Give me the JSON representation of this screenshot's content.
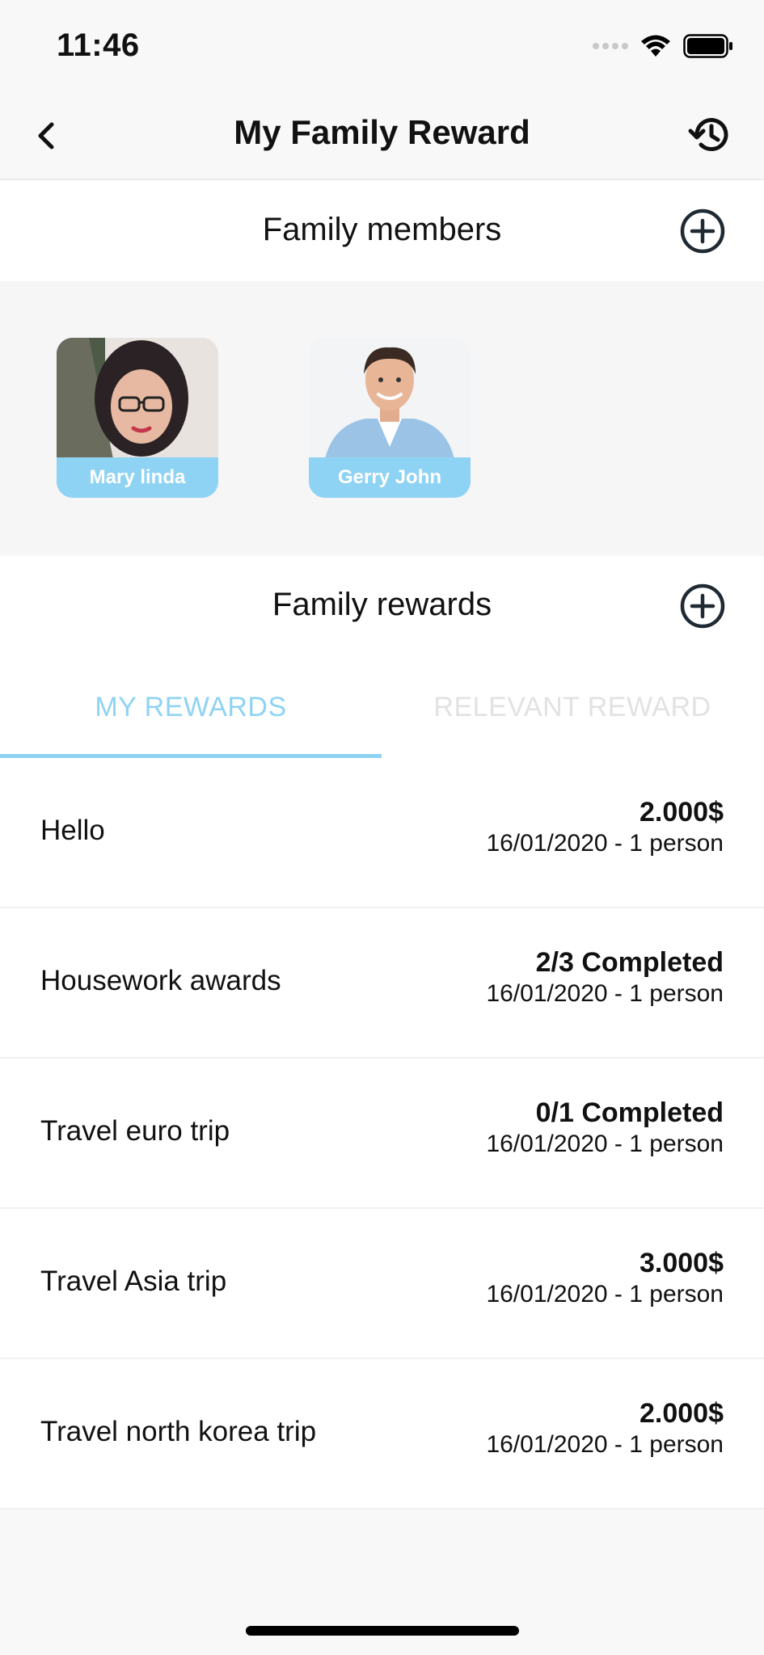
{
  "status_bar": {
    "time": "11:46"
  },
  "nav": {
    "title": "My Family Reward"
  },
  "members_section": {
    "title": "Family members"
  },
  "members": [
    {
      "name": "Mary linda"
    },
    {
      "name": "Gerry John"
    }
  ],
  "rewards_section": {
    "title": "Family rewards"
  },
  "tabs": [
    {
      "label": "MY REWARDS",
      "active": true
    },
    {
      "label": "RELEVANT REWARD",
      "active": false
    }
  ],
  "rewards": [
    {
      "name": "Hello",
      "value": "2.000$",
      "meta": "16/01/2020 - 1 person"
    },
    {
      "name": "Housework awards",
      "value": "2/3 Completed",
      "meta": "16/01/2020 - 1 person"
    },
    {
      "name": "Travel euro trip",
      "value": "0/1 Completed",
      "meta": "16/01/2020 - 1 person"
    },
    {
      "name": "Travel Asia trip",
      "value": "3.000$",
      "meta": "16/01/2020 - 1 person"
    },
    {
      "name": "Travel north korea trip",
      "value": "2.000$",
      "meta": "16/01/2020 - 1 person"
    }
  ],
  "colors": {
    "accent": "#8fd3f4",
    "tab_inactive": "#e2e2e2",
    "icon": "#1f2a33"
  }
}
